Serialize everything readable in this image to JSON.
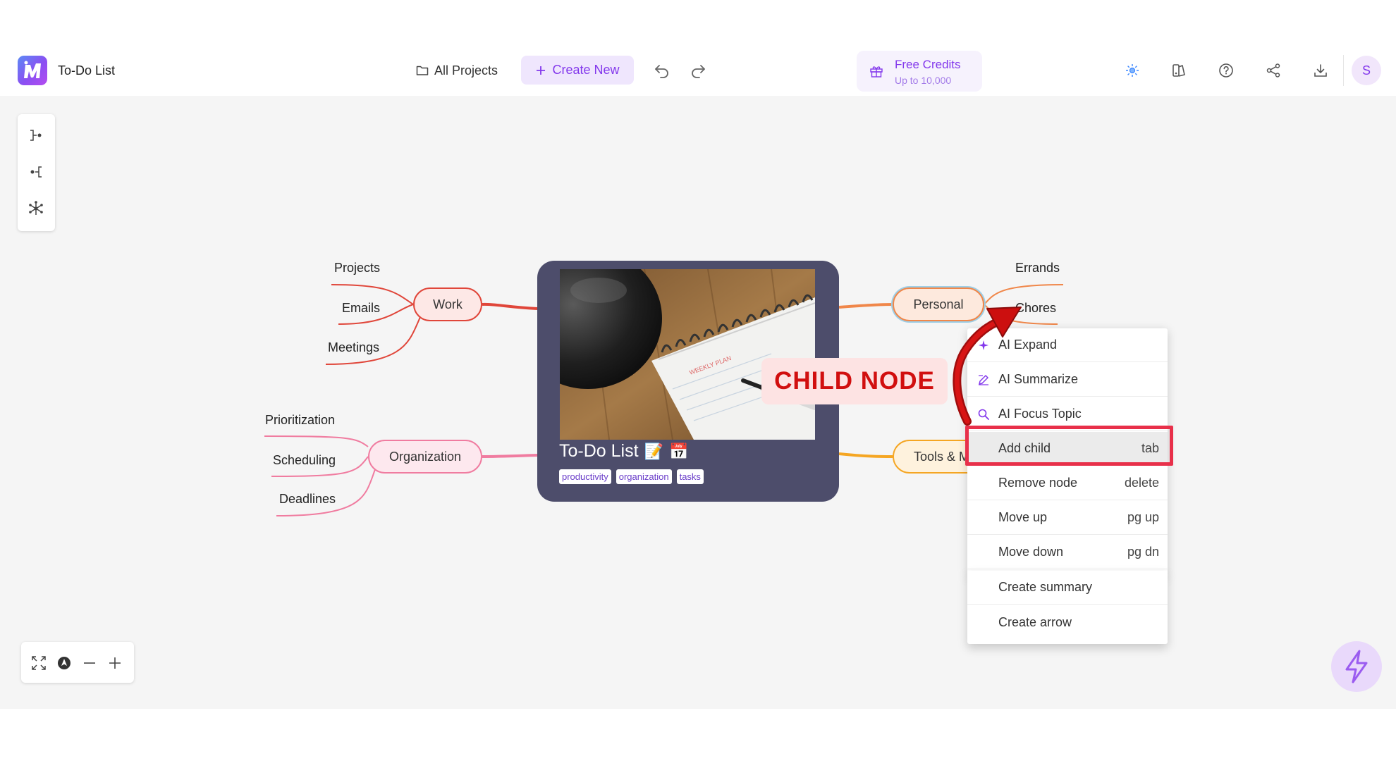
{
  "header": {
    "doc_title": "To-Do List",
    "all_projects_label": "All Projects",
    "create_new_label": "Create New",
    "credits_title": "Free Credits",
    "credits_subtitle": "Up to 10,000",
    "avatar_initial": "S"
  },
  "mindmap": {
    "central": {
      "title": "To-Do List",
      "emojis": [
        "📝",
        "📅"
      ],
      "tags": [
        "productivity",
        "organization",
        "tasks"
      ]
    },
    "branches": [
      {
        "label": "Work",
        "color": "#e0463a",
        "children": [
          "Projects",
          "Emails",
          "Meetings"
        ]
      },
      {
        "label": "Organization",
        "color": "#f07ca0",
        "children": [
          "Prioritization",
          "Scheduling",
          "Deadlines"
        ]
      },
      {
        "label": "Personal",
        "color": "#f0874a",
        "children": [
          "Errands",
          "Chores"
        ]
      },
      {
        "label": "Tools & M",
        "color": "#f5a623",
        "children": []
      }
    ]
  },
  "annotation": {
    "callout_text": "CHILD NODE",
    "arrow_color": "#cc0f0f",
    "highlight_color": "#e8304a"
  },
  "context_menu": {
    "items": [
      {
        "label": "AI Expand",
        "shortcut": "",
        "icon": "sparkle-icon"
      },
      {
        "label": "AI Summarize",
        "shortcut": "",
        "icon": "edit-icon"
      },
      {
        "label": "AI Focus Topic",
        "shortcut": "",
        "icon": "search-icon"
      },
      {
        "label": "Add child",
        "shortcut": "tab",
        "icon": ""
      },
      {
        "label": "Remove node",
        "shortcut": "delete",
        "icon": ""
      },
      {
        "label": "Move up",
        "shortcut": "pg up",
        "icon": ""
      },
      {
        "label": "Move down",
        "shortcut": "pg dn",
        "icon": ""
      },
      {
        "label": "Create summary",
        "shortcut": "",
        "icon": ""
      },
      {
        "label": "Create arrow",
        "shortcut": "",
        "icon": ""
      }
    ]
  },
  "colors": {
    "accent": "#8338ec",
    "canvas_bg": "#f5f5f5",
    "central_bg": "#4d4d6b"
  }
}
